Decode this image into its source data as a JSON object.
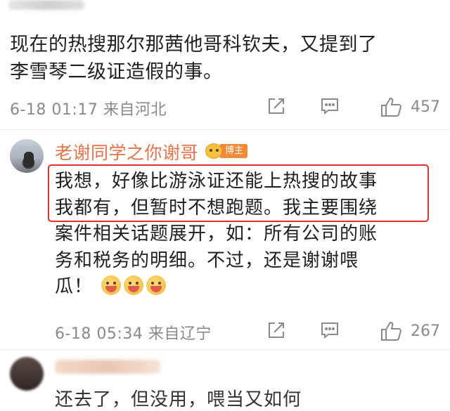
{
  "post": {
    "text_line1": "现在的热搜那尔那茜他哥科钦夫，又提到了",
    "text_line2": "李雪琴二级证造假的事。",
    "meta": "6-18 01:17 来自河北",
    "likes": "457"
  },
  "reply": {
    "author": "老谢同学之你谢哥",
    "badge": "博主",
    "line1": "我想，好像比游泳证还能上热搜的故事",
    "line2": "我都有，但暂时不想跑题。我主要围绕",
    "line3": "案件相关话题展开，如：所有公司的账",
    "line4": "务和税务的明细。不过，还是谢谢喂",
    "line5": "瓜！",
    "meta": "6-18 05:34 来自辽宁",
    "likes": "267"
  },
  "next": {
    "text": "还去了，但没用，喂当又如何"
  },
  "icons": {
    "share": "share-icon",
    "comment": "comment-icon",
    "like": "thumbs-up-icon",
    "emoji": "laughing-emoji-icon"
  },
  "colors": {
    "author": "#e8734a",
    "highlight_border": "#e0302c",
    "meta_gray": "#8a8a8a",
    "badge": "#f08a36"
  }
}
